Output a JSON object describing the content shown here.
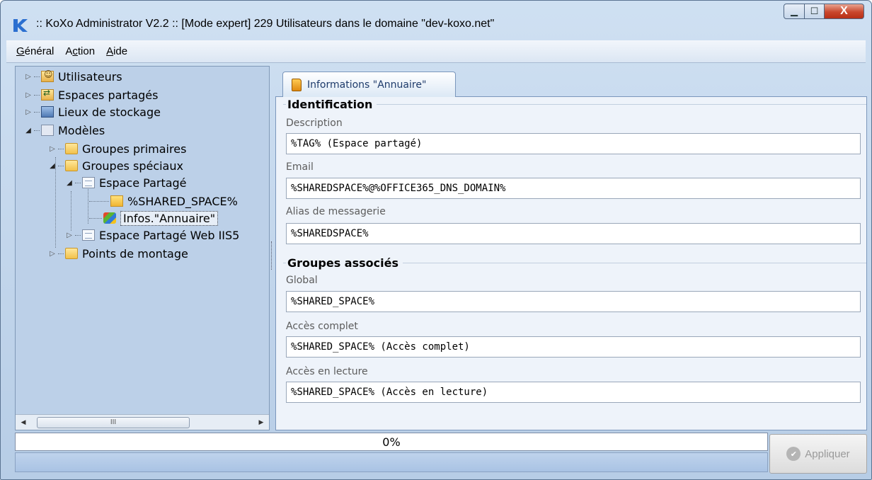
{
  "window": {
    "title": ":: KoXo Administrator V2.2 :: [Mode expert] 229 Utilisateurs dans le domaine \"dev-koxo.net\"",
    "buttons": {
      "minimize": "▁",
      "maximize": "☐",
      "close": "X"
    }
  },
  "menu": {
    "general": {
      "u": "G",
      "rest": "énéral"
    },
    "action": {
      "pre": "A",
      "u": "c",
      "rest": "tion"
    },
    "aide": {
      "u": "A",
      "rest": "ide"
    }
  },
  "tree": {
    "items": [
      {
        "label": "Utilisateurs",
        "icon": "users-folder-icon",
        "expanded": false
      },
      {
        "label": "Espaces partagés",
        "icon": "shared-folder-icon",
        "expanded": false
      },
      {
        "label": "Lieux de stockage",
        "icon": "storage-icon",
        "expanded": false
      },
      {
        "label": "Modèles",
        "icon": "models-icon",
        "expanded": true
      },
      {
        "label": "Groupes primaires",
        "icon": "folder-icon",
        "expanded": false
      },
      {
        "label": "Groupes spéciaux",
        "icon": "folder-icon",
        "expanded": true
      },
      {
        "label": "Espace Partagé",
        "icon": "document-icon",
        "expanded": true
      },
      {
        "label": "%SHARED_SPACE%",
        "icon": "folder-icon"
      },
      {
        "label": "Infos.\"Annuaire\"",
        "icon": "windows-icon",
        "selected": true
      },
      {
        "label": "Espace Partagé Web IIS5",
        "icon": "document-icon",
        "expanded": false
      },
      {
        "label": "Points de montage",
        "icon": "folder-icon",
        "expanded": false
      }
    ],
    "scroll_thumb_glyph": "III"
  },
  "tab": {
    "label": "Informations \"Annuaire\""
  },
  "identification": {
    "title": "Identification",
    "description_label": "Description",
    "description_value": "%TAG% (Espace partagé)",
    "email_label": "Email",
    "email_value": "%SHAREDSPACE%@%OFFICE365_DNS_DOMAIN%",
    "alias_label": "Alias de messagerie",
    "alias_value": "%SHAREDSPACE%"
  },
  "groups": {
    "title": "Groupes associés",
    "global_label": "Global",
    "global_value": "%SHARED_SPACE%",
    "full_label": "Accès complet",
    "full_value": "%SHARED_SPACE% (Accès complet)",
    "read_label": "Accès en lecture",
    "read_value": "%SHARED_SPACE% (Accès en lecture)"
  },
  "status": {
    "progress_text": "0%",
    "progress_value": 0
  },
  "apply_button": {
    "label": "Appliquer",
    "enabled": false
  },
  "colors": {
    "accent": "#1e3b6b",
    "background": "#bcd0e8"
  }
}
